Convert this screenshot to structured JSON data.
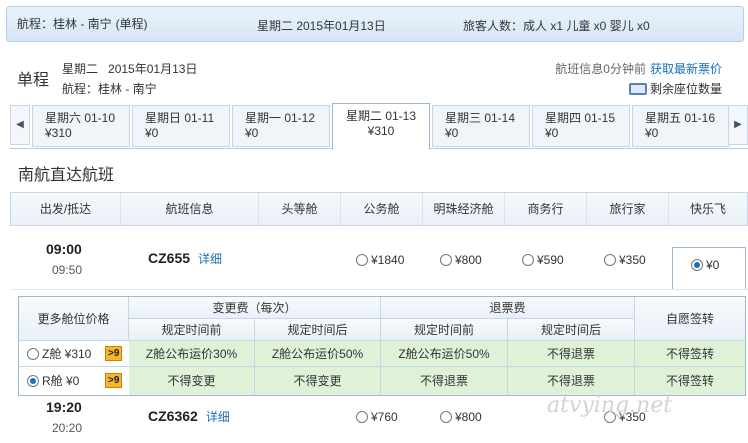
{
  "topbar": {
    "route_label": "航程：桂林 - 南宁",
    "trip_type": "(单程)",
    "date": "星期二 2015年01月13日",
    "passengers": "旅客人数：成人 x1 儿童 x0 婴儿 x0"
  },
  "summary": {
    "trip_type": "单程",
    "weekday": "星期二",
    "date": "2015年01月13日",
    "route": "航程：桂林 - 南宁",
    "updated": "航班信息0分钟前",
    "refresh_link": "获取最新票价",
    "remaining_seats": "剩余座位数量"
  },
  "date_tabs": [
    {
      "day": "星期六 01-10",
      "price": "¥310"
    },
    {
      "day": "星期日 01-11",
      "price": "¥0"
    },
    {
      "day": "星期一 01-12",
      "price": "¥0"
    },
    {
      "day": "星期二 01-13",
      "price": "¥310"
    },
    {
      "day": "星期三 01-14",
      "price": "¥0"
    },
    {
      "day": "星期四 01-15",
      "price": "¥0"
    },
    {
      "day": "星期五 01-16",
      "price": "¥0"
    }
  ],
  "section_title": "南航直达航班",
  "columns": [
    "出发/抵达",
    "航班信息",
    "头等舱",
    "公务舱",
    "明珠经济舱",
    "商务行",
    "旅行家",
    "快乐飞"
  ],
  "flight1": {
    "dep": "09:00",
    "arr": "09:50",
    "number": "CZ655",
    "detail": "详细",
    "fares": [
      "¥1840",
      "¥800",
      "¥590",
      "¥350",
      "¥0"
    ]
  },
  "more_fares": {
    "title": "更多舱位价格",
    "change_fee": "变更费（每次）",
    "refund_fee": "退票费",
    "endorse": "自愿签转",
    "before": "规定时间前",
    "after": "规定时间后",
    "rows": [
      {
        "cabin": "Z舱 ¥310",
        "tag": ">9",
        "c1": "Z舱公布运价30%",
        "c2": "Z舱公布运价50%",
        "c3": "Z舱公布运价50%",
        "c4": "不得退票",
        "c5": "不得签转"
      },
      {
        "cabin": "R舱 ¥0",
        "tag": ">9",
        "c1": "不得变更",
        "c2": "不得变更",
        "c3": "不得退票",
        "c4": "不得退票",
        "c5": "不得签转"
      }
    ]
  },
  "flight2": {
    "dep": "19:20",
    "arr": "20:20",
    "number": "CZ6362",
    "detail": "详细",
    "fares": [
      "¥760",
      "¥800",
      "¥350"
    ]
  },
  "watermark": "atvying.net"
}
